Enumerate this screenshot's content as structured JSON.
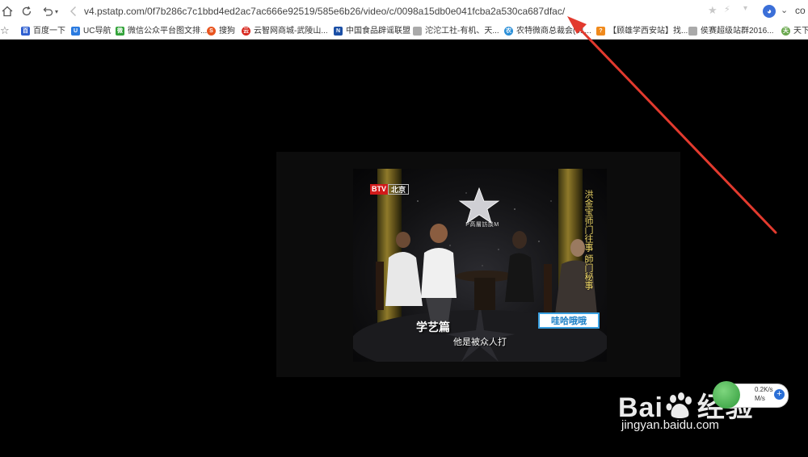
{
  "browser": {
    "url": "v4.pstatp.com/0f7b286c7c1bbd4ed2ac7ac666e92519/585e6b26/video/c/0098a15db0e041fcba2a530ca687dfac/",
    "tab_partial": "co",
    "icons": {
      "home": "home-icon",
      "refresh": "refresh-icon",
      "undo": "undo-icon",
      "back": "back-icon",
      "star": "star-icon",
      "lightning": "lightning-icon",
      "profile": "profile-icon"
    }
  },
  "bookmarks": [
    {
      "label": "百度一下",
      "fav_color": "#2f5fd0",
      "fav_text": "百"
    },
    {
      "label": "UC导航",
      "fav_color": "#2b7be0",
      "fav_text": "U"
    },
    {
      "label": "微信公众平台图文排...",
      "fav_color": "#33a33a",
      "fav_text": "微"
    },
    {
      "label": "搜狗",
      "fav_color": "#e8541f",
      "fav_text": "S"
    },
    {
      "label": "云智网商城-武陵山...",
      "fav_color": "#d8281f",
      "fav_text": "云"
    },
    {
      "label": "中国食品辟谣联盟",
      "fav_color": "#1b4fa6",
      "fav_text": "N"
    },
    {
      "label": "沱沱工社-有机、天...",
      "fav_color": "#999999",
      "fav_text": ""
    },
    {
      "label": "农特微商总裁会(01...",
      "fav_color": "#2a8fd8",
      "fav_text": "农"
    },
    {
      "label": "【顾雄学西安站】找...",
      "fav_color": "#f08a1c",
      "fav_text": "?"
    },
    {
      "label": "侯赛超级站群2016...",
      "fav_color": "#999999",
      "fav_text": ""
    },
    {
      "label": "天下",
      "fav_color": "#6aa84f",
      "fav_text": "天"
    }
  ],
  "video": {
    "channel_logo_red": "BTV",
    "channel_logo_city": "北京",
    "show_logo_text": "P高層訪談M",
    "vertical_caption": "洪金宝师门往事 師门秘事",
    "segment_title": "学艺篇",
    "brand_badge": "哇哈哦哦",
    "subtitle": "他是被众人打"
  },
  "annotation": {
    "arrow_color": "#e23a2e"
  },
  "watermark": {
    "brand": "Bai",
    "brand_suffix": "经验",
    "site": "jingyan.baidu.com",
    "net_upload": "0.2K/s",
    "net_download": "M/s",
    "net_plus": "+"
  }
}
